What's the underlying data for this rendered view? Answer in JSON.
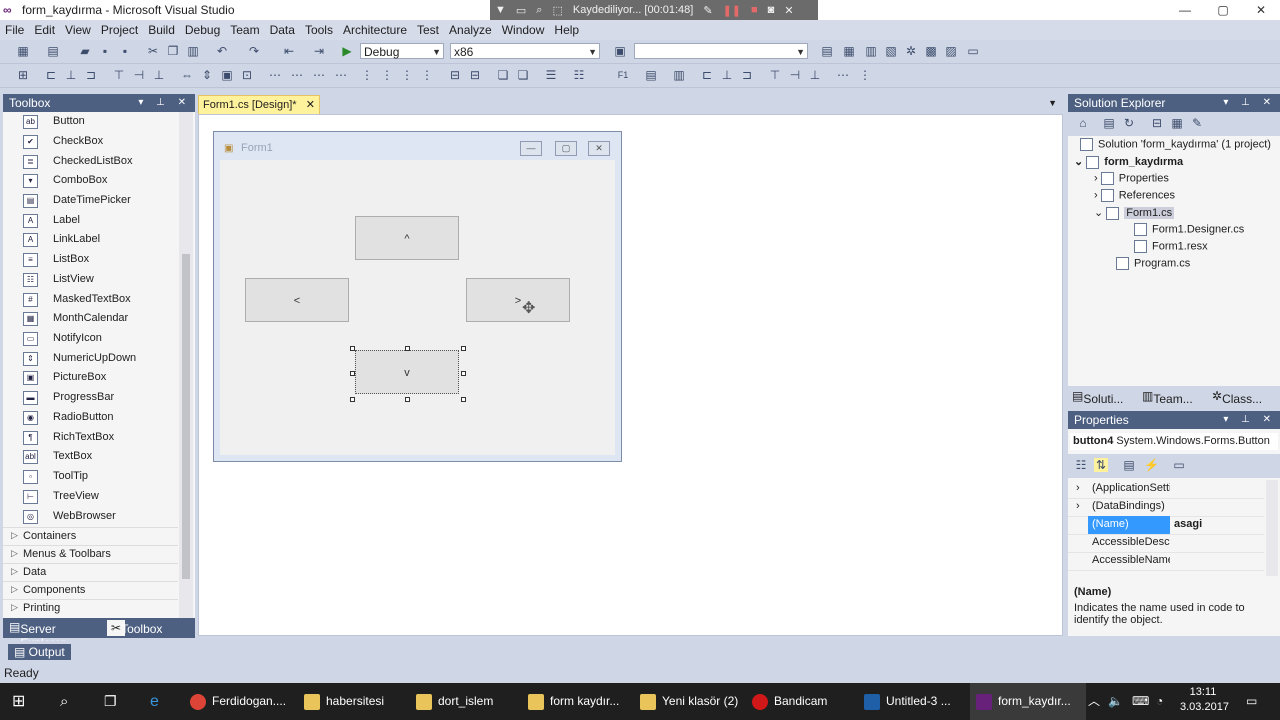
{
  "window": {
    "title": "form_kaydırma - Microsoft Visual Studio",
    "min": "—",
    "max": "▢",
    "close": "✕"
  },
  "recorder": {
    "text": "Kaydediliyor... [00:01:48]"
  },
  "menu": [
    "File",
    "Edit",
    "View",
    "Project",
    "Build",
    "Debug",
    "Team",
    "Data",
    "Tools",
    "Architecture",
    "Test",
    "Analyze",
    "Window",
    "Help"
  ],
  "toolbar": {
    "config": "Debug",
    "platform": "x86",
    "search": ""
  },
  "toolbox": {
    "title": "Toolbox",
    "items": [
      {
        "label": "Button",
        "icon": "ab"
      },
      {
        "label": "CheckBox",
        "icon": "✔"
      },
      {
        "label": "CheckedListBox",
        "icon": "≣"
      },
      {
        "label": "ComboBox",
        "icon": "▾"
      },
      {
        "label": "DateTimePicker",
        "icon": "▤"
      },
      {
        "label": "Label",
        "icon": "A"
      },
      {
        "label": "LinkLabel",
        "icon": "A"
      },
      {
        "label": "ListBox",
        "icon": "≡"
      },
      {
        "label": "ListView",
        "icon": "☷"
      },
      {
        "label": "MaskedTextBox",
        "icon": "#"
      },
      {
        "label": "MonthCalendar",
        "icon": "▦"
      },
      {
        "label": "NotifyIcon",
        "icon": "▭"
      },
      {
        "label": "NumericUpDown",
        "icon": "⇕"
      },
      {
        "label": "PictureBox",
        "icon": "▣"
      },
      {
        "label": "ProgressBar",
        "icon": "▬"
      },
      {
        "label": "RadioButton",
        "icon": "◉"
      },
      {
        "label": "RichTextBox",
        "icon": "¶"
      },
      {
        "label": "TextBox",
        "icon": "abl"
      },
      {
        "label": "ToolTip",
        "icon": "▫"
      },
      {
        "label": "TreeView",
        "icon": "⊢"
      },
      {
        "label": "WebBrowser",
        "icon": "◎"
      }
    ],
    "categories": [
      "Containers",
      "Menus & Toolbars",
      "Data",
      "Components",
      "Printing"
    ],
    "tabs": {
      "server_explorer": "Server Explorer",
      "toolbox": "Toolbox"
    }
  },
  "document": {
    "tab": "Form1.cs [Design]*",
    "form_title": "Form1",
    "buttons": {
      "up": "^",
      "left": "<",
      "right": ">",
      "down": "v"
    }
  },
  "solution_explorer": {
    "title": "Solution Explorer",
    "items": [
      "Solution 'form_kaydırma' (1 project)",
      "form_kaydırma",
      "Properties",
      "References",
      "Form1.cs",
      "Form1.Designer.cs",
      "Form1.resx",
      "Program.cs"
    ],
    "tabs": [
      "Soluti...",
      "Team...",
      "Class..."
    ]
  },
  "properties": {
    "title": "Properties",
    "object": "button4",
    "object_type": "System.Windows.Forms.Button",
    "rows": [
      {
        "name": "(ApplicationSettings)",
        "value": ""
      },
      {
        "name": "(DataBindings)",
        "value": ""
      },
      {
        "name": "(Name)",
        "value": "asagi"
      },
      {
        "name": "AccessibleDescription",
        "value": ""
      },
      {
        "name": "AccessibleName",
        "value": ""
      }
    ],
    "desc_title": "(Name)",
    "desc_text": "Indicates the name used in code to identify the object."
  },
  "output": {
    "label": "Output"
  },
  "status": {
    "text": "Ready"
  },
  "taskbar": {
    "items": [
      "Ferdidogan....",
      "habersitesi",
      "dort_islem",
      "form kaydır...",
      "Yeni klasör (2)",
      "Bandicam",
      "Untitled-3 ...",
      "form_kaydır..."
    ],
    "time": "13:11",
    "date": "3.03.2017"
  },
  "colors": {
    "accent": "#4D6082",
    "doctab": "#FFF29D",
    "selection": "#3399FF"
  }
}
